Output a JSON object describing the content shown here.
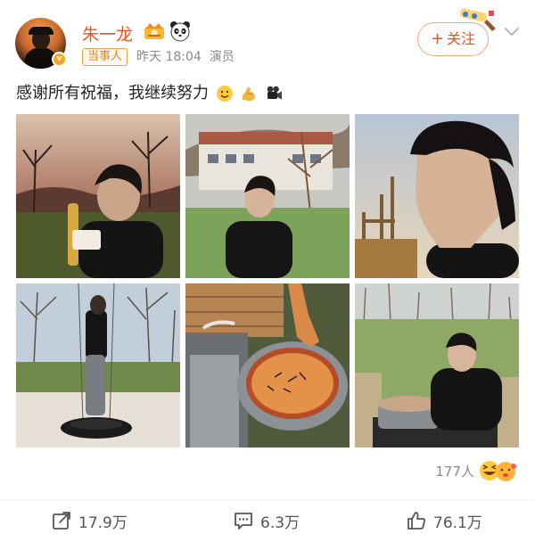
{
  "user": {
    "name": "朱一龙",
    "tag": "当事人",
    "time": "昨天 18:04",
    "source": "演员",
    "icons": [
      "vip-icon",
      "panda-icon",
      "verified-badge-icon"
    ]
  },
  "follow": {
    "label": "关注",
    "icon": "plus-icon"
  },
  "post": {
    "text": "感谢所有祝福，我继续努力",
    "emojis": [
      "smile-emoji",
      "muscle-emoji",
      "movie-camera-emoji"
    ]
  },
  "photos": [
    {
      "id": "photo-1",
      "description_icon": "photo"
    },
    {
      "id": "photo-2",
      "description_icon": "photo"
    },
    {
      "id": "photo-3",
      "description_icon": "photo"
    },
    {
      "id": "photo-4",
      "description_icon": "photo"
    },
    {
      "id": "photo-5",
      "description_icon": "photo"
    },
    {
      "id": "photo-6",
      "description_icon": "photo"
    }
  ],
  "reactions": {
    "count": "177人"
  },
  "actions": {
    "share_count": "17.9万",
    "comment_count": "6.3万",
    "like_count": "76.1万"
  },
  "colors": {
    "accent": "#e8541e",
    "tag_border": "#f0a44a",
    "meta_gray": "#8a8a8a"
  }
}
